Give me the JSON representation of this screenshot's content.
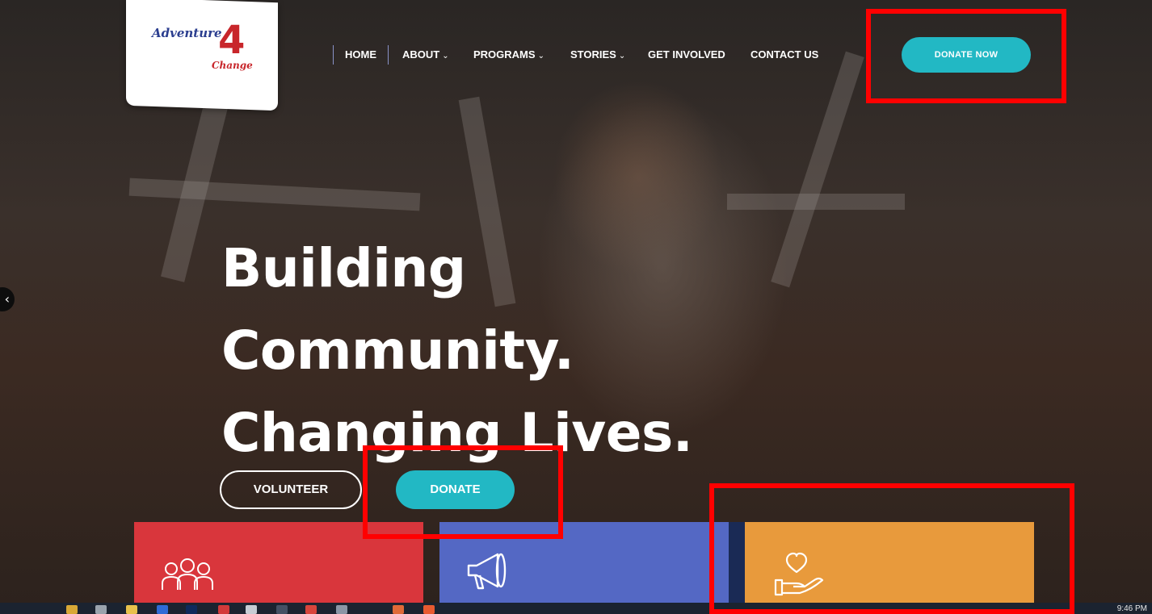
{
  "logo": {
    "word1": "Adventure",
    "four": "4",
    "word2": "Change"
  },
  "nav": {
    "items": [
      {
        "label": "HOME",
        "has_dropdown": false,
        "active": true
      },
      {
        "label": "ABOUT",
        "has_dropdown": true
      },
      {
        "label": "PROGRAMS",
        "has_dropdown": true
      },
      {
        "label": "STORIES",
        "has_dropdown": true
      },
      {
        "label": "GET INVOLVED",
        "has_dropdown": false
      },
      {
        "label": "CONTACT US",
        "has_dropdown": false
      }
    ],
    "dropdown_glyph": "⌄"
  },
  "header_button": {
    "label": "DONATE NOW"
  },
  "hero": {
    "headline": [
      "Building",
      "Community.",
      "Changing Lives."
    ],
    "buttons": {
      "volunteer": "VOLUNTEER",
      "donate": "DONATE"
    },
    "slider_prev_glyph": "‹"
  },
  "tiles": [
    {
      "icon": "people-icon",
      "color": "#d9363c"
    },
    {
      "icon": "megaphone-icon",
      "color": "#5468c4"
    },
    {
      "icon": "heart-hand-icon",
      "color": "#e89a3c"
    }
  ],
  "taskbar": {
    "clock": "9:46 PM"
  },
  "colors": {
    "accent": "#22b8c4",
    "highlight_box": "#ff0000",
    "logo_blue": "#2b3e8f",
    "logo_red": "#c8262b"
  }
}
